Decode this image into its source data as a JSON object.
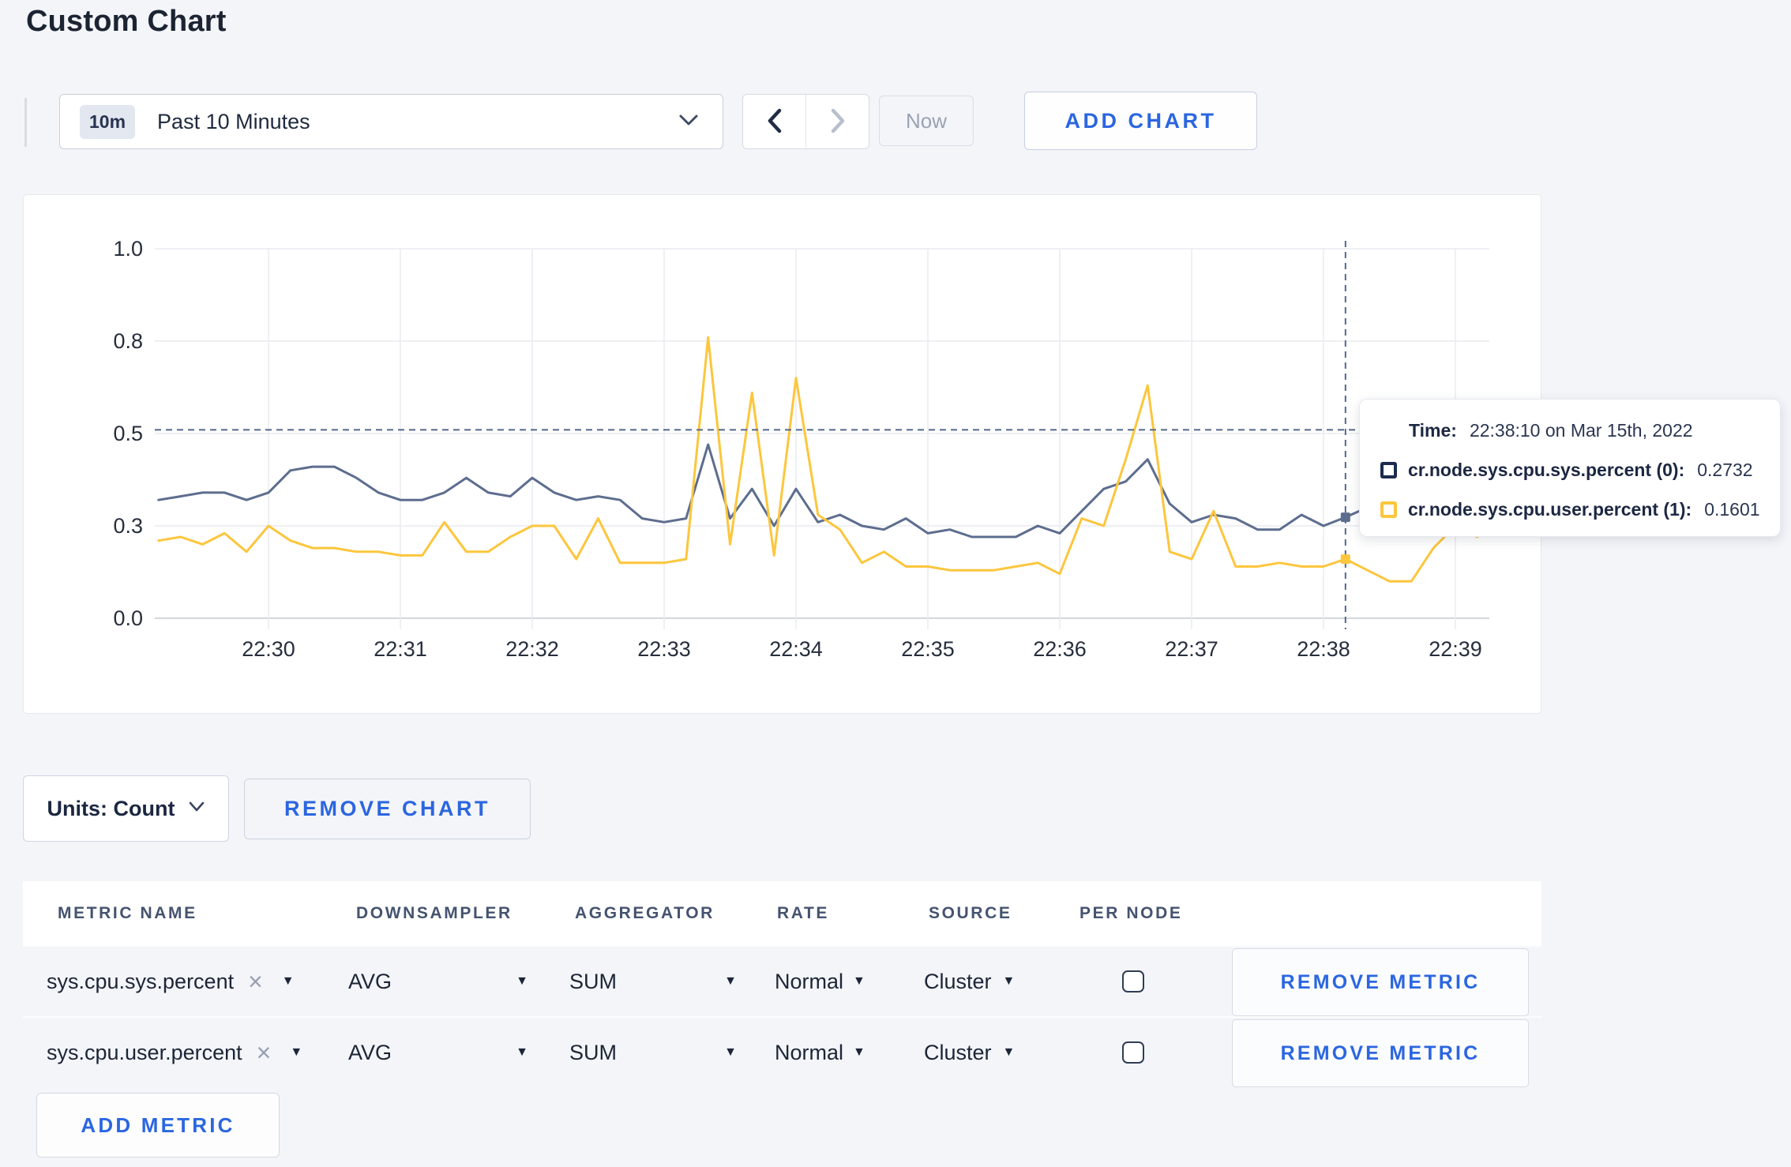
{
  "page": {
    "title": "Custom Chart"
  },
  "toolbar": {
    "time_window_badge": "10m",
    "time_window_label": "Past 10 Minutes",
    "now_label": "Now",
    "add_chart_label": "ADD CHART"
  },
  "chart_data": {
    "type": "line",
    "title": "",
    "xlabel": "",
    "ylabel": "",
    "ylim": [
      0,
      1
    ],
    "grid": true,
    "legend_position": "none",
    "x_ticks": [
      "22:30",
      "22:31",
      "22:32",
      "22:33",
      "22:34",
      "22:35",
      "22:36",
      "22:37",
      "22:38",
      "22:39"
    ],
    "y_axis": {
      "values": [
        0,
        0.25,
        0.5,
        0.75,
        1.0
      ],
      "labels": [
        "0.0",
        "0.3",
        "0.5",
        "0.8",
        "1.0"
      ]
    },
    "x_start": "22:29:10",
    "interval_seconds": 10,
    "series": [
      {
        "name": "cr.node.sys.cpu.sys.percent",
        "color": "#5d6d8e",
        "values": [
          0.32,
          0.33,
          0.34,
          0.34,
          0.32,
          0.34,
          0.4,
          0.41,
          0.41,
          0.38,
          0.34,
          0.32,
          0.32,
          0.34,
          0.38,
          0.34,
          0.33,
          0.38,
          0.34,
          0.32,
          0.33,
          0.32,
          0.27,
          0.26,
          0.27,
          0.47,
          0.27,
          0.35,
          0.25,
          0.35,
          0.26,
          0.28,
          0.25,
          0.24,
          0.27,
          0.23,
          0.24,
          0.22,
          0.22,
          0.22,
          0.25,
          0.23,
          0.29,
          0.35,
          0.37,
          0.43,
          0.31,
          0.26,
          0.28,
          0.27,
          0.24,
          0.24,
          0.28,
          0.25,
          0.2732,
          0.3,
          0.3,
          0.29,
          0.3,
          0.31,
          0.3
        ]
      },
      {
        "name": "cr.node.sys.cpu.user.percent",
        "color": "#fcc63d",
        "values": [
          0.21,
          0.22,
          0.2,
          0.23,
          0.18,
          0.25,
          0.21,
          0.19,
          0.19,
          0.18,
          0.18,
          0.17,
          0.17,
          0.26,
          0.18,
          0.18,
          0.22,
          0.25,
          0.25,
          0.16,
          0.27,
          0.15,
          0.15,
          0.15,
          0.16,
          0.76,
          0.2,
          0.61,
          0.17,
          0.65,
          0.28,
          0.24,
          0.15,
          0.18,
          0.14,
          0.14,
          0.13,
          0.13,
          0.13,
          0.14,
          0.15,
          0.12,
          0.27,
          0.25,
          0.43,
          0.63,
          0.18,
          0.16,
          0.29,
          0.14,
          0.14,
          0.15,
          0.14,
          0.14,
          0.1601,
          0.13,
          0.1,
          0.1,
          0.19,
          0.25,
          0.22
        ]
      }
    ],
    "hover": {
      "time": "22:38:10",
      "values": [
        0.2732,
        0.1601
      ],
      "crosshair_y_value": 0.51
    }
  },
  "tooltip": {
    "time_label": "Time:",
    "time_value": "22:38:10 on Mar 15th, 2022",
    "entries": [
      {
        "label": "cr.node.sys.cpu.sys.percent (0):",
        "value": "0.2732",
        "color": "#1c2b4d"
      },
      {
        "label": "cr.node.sys.cpu.user.percent (1):",
        "value": "0.1601",
        "color": "#fcc63d"
      }
    ]
  },
  "units_bar": {
    "units_label": "Units: Count",
    "remove_chart_label": "REMOVE CHART"
  },
  "metrics_table": {
    "headers": [
      "METRIC NAME",
      "DOWNSAMPLER",
      "AGGREGATOR",
      "RATE",
      "SOURCE",
      "PER NODE"
    ],
    "rows": [
      {
        "metric": "sys.cpu.sys.percent",
        "downsampler": "AVG",
        "aggregator": "SUM",
        "rate": "Normal",
        "source": "Cluster",
        "per_node_checked": false,
        "remove_label": "REMOVE METRIC"
      },
      {
        "metric": "sys.cpu.user.percent",
        "downsampler": "AVG",
        "aggregator": "SUM",
        "rate": "Normal",
        "source": "Cluster",
        "per_node_checked": false,
        "remove_label": "REMOVE METRIC"
      }
    ],
    "add_metric_label": "ADD METRIC"
  },
  "colors": {
    "accent_blue": "#2b66e0",
    "page_bg": "#f4f5f9",
    "row_bg": "#f3f5f9",
    "crosshair": "#54688c"
  }
}
